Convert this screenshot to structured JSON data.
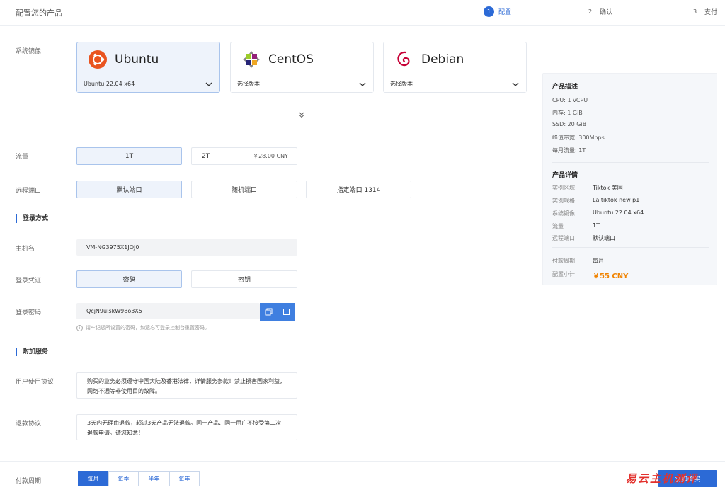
{
  "header": {
    "title": "配置您的产品",
    "steps": [
      {
        "num": "1",
        "label": "配置"
      },
      {
        "num": "2",
        "label": "确认"
      },
      {
        "num": "3",
        "label": "支付"
      }
    ]
  },
  "form": {
    "os_label": "系统镜像",
    "os_options": [
      {
        "name": "Ubuntu",
        "version": "Ubuntu 22.04 x64",
        "logo": "ubuntu-logo"
      },
      {
        "name": "CentOS",
        "version": "选择版本",
        "logo": "centos-logo"
      },
      {
        "name": "Debian",
        "version": "选择版本",
        "logo": "debian-logo"
      }
    ],
    "traffic_label": "流量",
    "traffic_options": [
      {
        "label": "1T",
        "price": ""
      },
      {
        "label": "2T",
        "price": "￥28.00 CNY"
      }
    ],
    "port_label": "远程端口",
    "port_options": [
      "默认端口",
      "随机端口",
      "指定端口 1314"
    ],
    "login_section": "登录方式",
    "hostname_label": "主机名",
    "hostname_value": "VM-NG3975X1JOJ0",
    "credential_label": "登录凭证",
    "credential_options": [
      "密码",
      "密钥"
    ],
    "password_label": "登录密码",
    "password_value": "QcjN9uIskW98o3X5",
    "password_hint": "请牢记您所设置的密码，如遗忘可登录控制台重置密码。",
    "extras_section": "附加服务",
    "agreement_label": "用户使用协议",
    "agreement_text": "购买的业务必须遵守中国大陆及香港法律，详情服务条款！禁止损害国家利益，网络不通等非使用目的故障。",
    "refund_label": "退款协议",
    "refund_text": "3天内无理由退款，超过3天产品无法退款。同一产品、同一用户不接受第二次退款申请。请您知悉！"
  },
  "summary": {
    "desc_title": "产品描述",
    "specs": [
      "CPU: 1 vCPU",
      "内存: 1 GiB",
      "SSD: 20 GiB",
      "峰值带宽: 300Mbps",
      "每月流量: 1T"
    ],
    "detail_title": "产品详情",
    "details": [
      {
        "k": "实例区域",
        "v": "Tiktok 美国"
      },
      {
        "k": "实例规格",
        "v": "La tiktok new p1"
      },
      {
        "k": "系统镜像",
        "v": "Ubuntu 22.04 x64"
      },
      {
        "k": "流量",
        "v": "1T"
      },
      {
        "k": "远程端口",
        "v": "默认端口"
      }
    ],
    "cycle_k": "付款周期",
    "cycle_v": "每月",
    "total_k": "配置小计",
    "total_v": "￥55 CNY"
  },
  "footer": {
    "cycle_label": "付款周期",
    "cycles": [
      "每月",
      "每季",
      "半年",
      "每年"
    ],
    "submit": "立即购买",
    "watermark": "易云主机测评"
  },
  "colors": {
    "accent": "#2c6ad6",
    "total": "#f08300"
  }
}
